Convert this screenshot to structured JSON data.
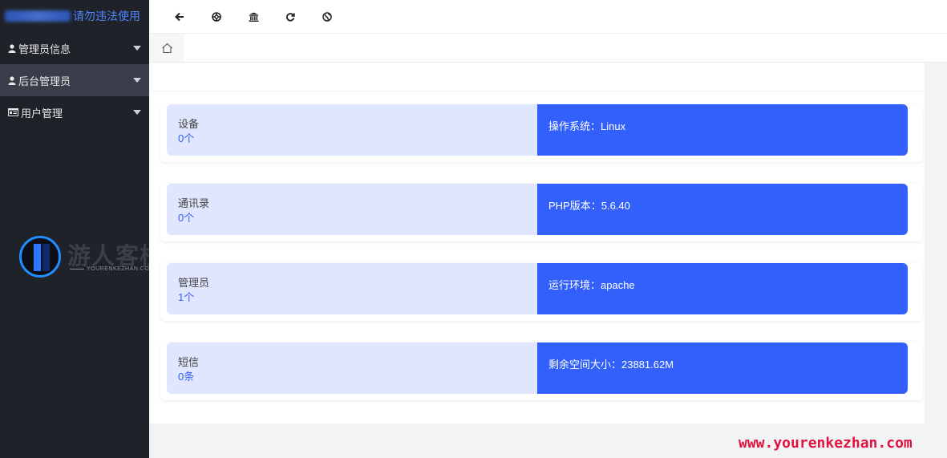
{
  "sidebar": {
    "brand_text": "请勿违法使用",
    "items": [
      {
        "label": "管理员信息",
        "icon": "user-icon"
      },
      {
        "label": "后台管理员",
        "icon": "user-icon"
      },
      {
        "label": "用户管理",
        "icon": "id-card-icon"
      }
    ]
  },
  "toolbar": {
    "icons": [
      "back-arrow-icon",
      "lifebuoy-icon",
      "bank-icon",
      "refresh-icon",
      "globe-icon"
    ]
  },
  "cards": [
    {
      "label": "设备",
      "count": "0个",
      "info": "操作系统：Linux"
    },
    {
      "label": "通讯录",
      "count": "0个",
      "info": "PHP版本：5.6.40"
    },
    {
      "label": "管理员",
      "count": "1个",
      "info": "运行环境：apache"
    },
    {
      "label": "短信",
      "count": "0条",
      "info": "剩余空间大小：23881.62M"
    }
  ],
  "watermark": {
    "title": "游人客栈",
    "subtitle": "YOURENKEZHAN.COM",
    "site": "www.yourenkezhan.com"
  },
  "colors": {
    "sidebar_bg": "#1f2229",
    "active_item_bg": "#393d49",
    "accent_blue": "#3360fa",
    "card_light": "#dfe6fd",
    "site_red": "#e0123f"
  }
}
